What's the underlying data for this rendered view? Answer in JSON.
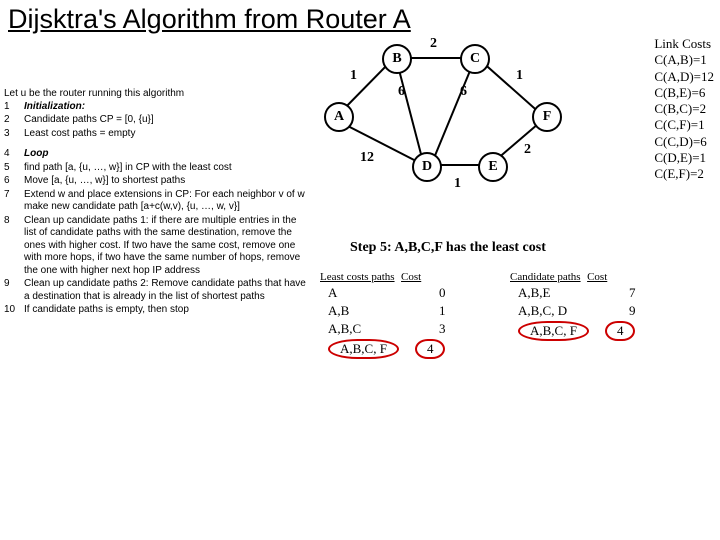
{
  "title": "Dijsktra's Algorithm from Router A",
  "algo_intro": "Let u be the router running this algorithm",
  "algo": {
    "l1_num": "1",
    "l1": "Initialization:",
    "l2_num": "2",
    "l2": "Candidate paths CP = [0, {u}]",
    "l3_num": "3",
    "l3": "Least cost paths = empty",
    "l4_num": "4",
    "l4": "Loop",
    "l5_num": "5",
    "l5": "find path [a, {u, …, w}] in CP with the least cost",
    "l6_num": "6",
    "l6": "Move [a, {u, …, w}] to shortest paths",
    "l7_num": "7",
    "l7": "Extend w and place extensions in CP: For each neighbor v of w make new candidate path [a+c(w,v), {u, …, w, v}]",
    "l8_num": "8",
    "l8": "Clean up candidate paths 1: if there are multiple entries in the list of candidate paths with the same destination, remove the ones with higher cost. If two have the same cost, remove one with more hops, if two have the same number of hops, remove the one with higher next hop IP address",
    "l9_num": "9",
    "l9": "Clean up candidate paths 2: Remove candidate paths that have a destination that is already in the list of shortest paths",
    "l10_num": "10",
    "l10": "If candidate paths is empty, then stop"
  },
  "nodes": {
    "A": "A",
    "B": "B",
    "C": "C",
    "D": "D",
    "E": "E",
    "F": "F"
  },
  "edge_labels": {
    "AB": "1",
    "BC": "2",
    "CF": "1",
    "BE_or_BD": "6",
    "CE_or_CD": "6",
    "AD": "12",
    "DE": "1",
    "EF": "2"
  },
  "link_costs": {
    "title": "Link Costs",
    "rows": [
      "C(A,B)=1",
      "C(A,D)=12",
      "C(B,E)=6",
      "C(B,C)=2",
      "C(C,F)=1",
      "C(C,D)=6",
      "C(D,E)=1",
      "C(E,F)=2"
    ]
  },
  "step_caption": "Step 5: A,B,C,F has the least cost",
  "least_header1": "Least costs paths",
  "least_header2": "Cost",
  "least_rows": [
    {
      "p": "A",
      "c": "0"
    },
    {
      "p": "A,B",
      "c": "1"
    },
    {
      "p": "A,B,C",
      "c": "3"
    },
    {
      "p": "A,B,C, F",
      "c": "4",
      "highlight": true
    }
  ],
  "cand_header1": "Candidate paths",
  "cand_header2": "Cost",
  "cand_rows": [
    {
      "p": "A,B,E",
      "c": "7"
    },
    {
      "p": "A,B,C, D",
      "c": "9"
    },
    {
      "p": "A,B,C, F",
      "c": "4",
      "highlight": true
    }
  ],
  "chart_data": {
    "type": "graph",
    "nodes": [
      "A",
      "B",
      "C",
      "D",
      "E",
      "F"
    ],
    "edges": [
      {
        "from": "A",
        "to": "B",
        "w": 1
      },
      {
        "from": "A",
        "to": "D",
        "w": 12
      },
      {
        "from": "B",
        "to": "C",
        "w": 2
      },
      {
        "from": "B",
        "to": "E",
        "w": 6
      },
      {
        "from": "C",
        "to": "D",
        "w": 6
      },
      {
        "from": "C",
        "to": "F",
        "w": 1
      },
      {
        "from": "D",
        "to": "E",
        "w": 1
      },
      {
        "from": "E",
        "to": "F",
        "w": 2
      }
    ],
    "source": "A",
    "step": 5,
    "shortest_paths": [
      {
        "path": [
          "A"
        ],
        "cost": 0
      },
      {
        "path": [
          "A",
          "B"
        ],
        "cost": 1
      },
      {
        "path": [
          "A",
          "B",
          "C"
        ],
        "cost": 3
      },
      {
        "path": [
          "A",
          "B",
          "C",
          "F"
        ],
        "cost": 4
      }
    ],
    "candidate_paths": [
      {
        "path": [
          "A",
          "B",
          "E"
        ],
        "cost": 7
      },
      {
        "path": [
          "A",
          "B",
          "C",
          "D"
        ],
        "cost": 9
      },
      {
        "path": [
          "A",
          "B",
          "C",
          "F"
        ],
        "cost": 4
      }
    ],
    "selected_candidate": {
      "path": [
        "A",
        "B",
        "C",
        "F"
      ],
      "cost": 4
    }
  }
}
